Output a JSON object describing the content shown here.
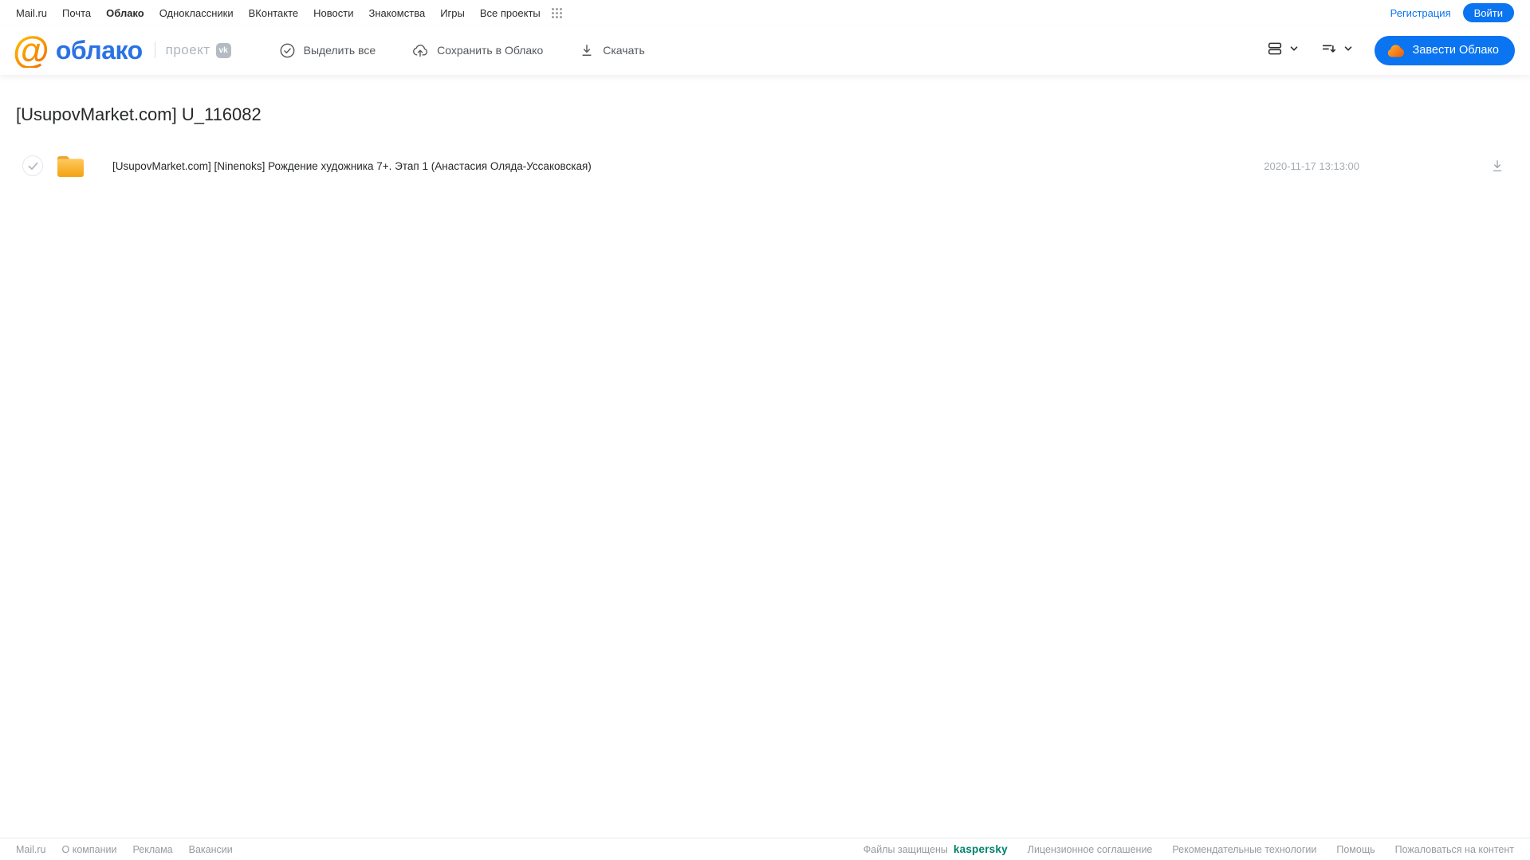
{
  "topbar": {
    "links": [
      "Mail.ru",
      "Почта",
      "Облако",
      "Одноклассники",
      "ВКонтакте",
      "Новости",
      "Знакомства",
      "Игры",
      "Все проекты"
    ],
    "active_link": "Облако",
    "registration": "Регистрация",
    "login": "Войти"
  },
  "header": {
    "logo_at": "@",
    "logo_text": "облако",
    "project_label": "проект",
    "vk_badge": "vk",
    "toolbar": [
      {
        "icon": "check-circle-icon",
        "label": "Выделить все"
      },
      {
        "icon": "cloud-upload-icon",
        "label": "Сохранить в Облако"
      },
      {
        "icon": "download-icon",
        "label": "Скачать"
      }
    ],
    "create_cloud_button": "Завести Облако"
  },
  "main": {
    "title": "[UsupovMarket.com] U_116082",
    "files": [
      {
        "type": "folder",
        "name": "[UsupovMarket.com] [Ninenoks] Рождение художника 7+. Этап 1 (Анастасия Оляда-Уссаковская)",
        "date": "2020-11-17 13:13:00"
      }
    ]
  },
  "footer": {
    "left_links": [
      "Mail.ru",
      "О компании",
      "Реклама",
      "Вакансии"
    ],
    "protected_label": "Файлы защищены",
    "kaspersky_logo": "kaspersky",
    "right_links": [
      "Лицензионное соглашение",
      "Рекомендательные технологии",
      "Помощь",
      "Пожаловаться на контент"
    ]
  },
  "colors": {
    "accent_blue": "#0b74f0",
    "logo_blue": "#2a72e5",
    "logo_orange_start": "#ffb301",
    "logo_orange_end": "#f07800",
    "folder_yellow_top": "#ffc75a",
    "folder_yellow_bottom": "#f3a51a",
    "kaspersky_green": "#00816b",
    "text_dark": "#2c2d2e",
    "text_gray": "#969aa1"
  }
}
